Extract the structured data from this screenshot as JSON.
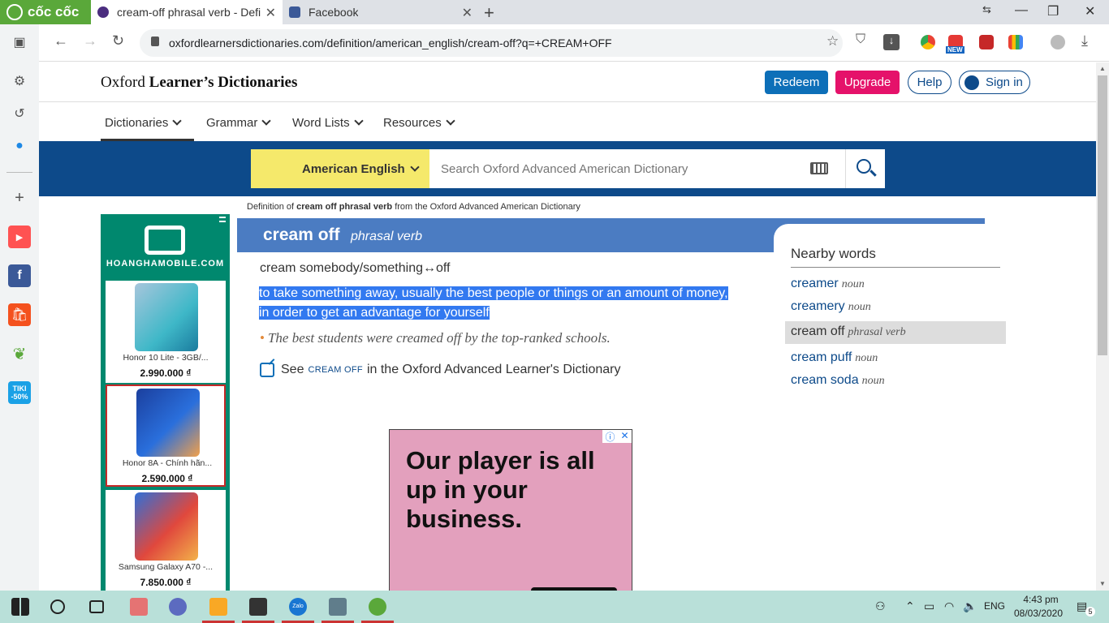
{
  "browser": {
    "brand": "cốc cốc",
    "tabs": [
      {
        "title": "cream-off phrasal verb - Defi",
        "active": true
      },
      {
        "title": "Facebook",
        "active": false
      }
    ],
    "url": "oxfordlearnersdictionaries.com/definition/american_english/cream-off?q=+CREAM+OFF",
    "extension_badge": "NEW"
  },
  "sidebar": {
    "tiki_label": "TIKI",
    "tiki_badge": "-50%"
  },
  "site": {
    "logo_light": "Oxford ",
    "logo_bold": "Learner’s Dictionaries",
    "redeem": "Redeem",
    "upgrade": "Upgrade",
    "help": "Help",
    "sign_in": "Sign in",
    "nav": [
      "Dictionaries",
      "Grammar",
      "Word Lists",
      "Resources"
    ],
    "dictionary_select": "American English",
    "search_placeholder": "Search Oxford Advanced American Dictionary"
  },
  "ad_left": {
    "brand": "HOANGHAMOBILE.COM",
    "products": [
      {
        "name": "Honor 10 Lite - 3GB/...",
        "price": "2.990.000 ₫"
      },
      {
        "name": "Honor 8A - Chính hãn...",
        "price": "2.590.000 ₫"
      },
      {
        "name": "Samsung Galaxy A70 -...",
        "price": "7.850.000 ₫"
      }
    ]
  },
  "entry": {
    "source_prefix": "Definition of ",
    "source_word": "cream off phrasal verb",
    "source_suffix": " from the Oxford Advanced American Dictionary",
    "headword": "cream off",
    "pos": "phrasal verb",
    "frame": "cream somebody/something↔off",
    "definition_line1": "to take something away, usually the best people or things or an amount of money,",
    "definition_line2": "in order to get an advantage for yourself",
    "example": "The best students were creamed off by the top-ranked schools.",
    "see_prefix": "See",
    "see_word": "cream off",
    "see_suffix": "in the Oxford Advanced Learner's Dictionary"
  },
  "nearby": {
    "title": "Nearby words",
    "words": [
      {
        "word": "creamer",
        "pos": "noun",
        "current": false
      },
      {
        "word": "creamery",
        "pos": "noun",
        "current": false
      },
      {
        "word": "cream off",
        "pos": "phrasal verb",
        "current": true
      },
      {
        "word": "cream puff",
        "pos": "noun",
        "current": false
      },
      {
        "word": "cream soda",
        "pos": "noun",
        "current": false
      }
    ]
  },
  "ad_bottom": {
    "text": "Our player is all up in your business."
  },
  "taskbar": {
    "lang": "ENG",
    "time": "4:43 pm",
    "date": "08/03/2020",
    "notifications": "5",
    "zalo": "Zalo"
  },
  "colors": {
    "oxford_blue": "#0d4a8a",
    "entry_blue": "#4b7cc2",
    "redeem": "#0d6fb8",
    "upgrade": "#e5126a",
    "dict_yellow": "#f5e96b",
    "ad_green": "#00886e",
    "selection": "#3279f0"
  }
}
